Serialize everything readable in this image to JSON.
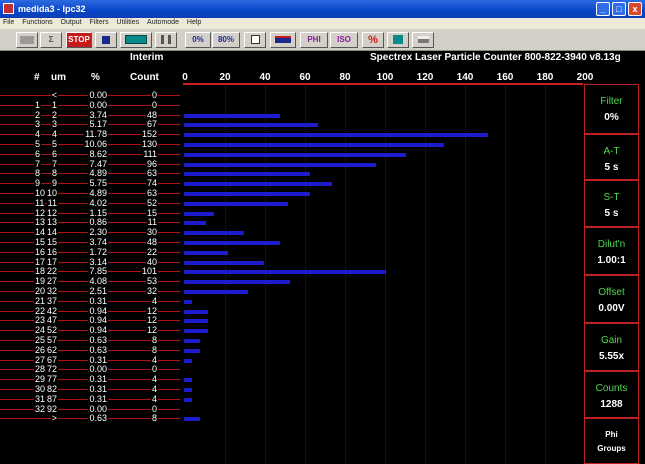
{
  "window": {
    "title": "medida3 - lpc32",
    "min": "_",
    "max": "□",
    "close": "x"
  },
  "menu": [
    "File",
    "Functions",
    "Output",
    "Filters",
    "Utilities",
    "Automode",
    "Help"
  ],
  "toolbar": {
    "sigma": "Σ",
    "stop": "STOP",
    "percent_label": "0%",
    "percent80_label": "80%",
    "phi": "PHI",
    "iso": "ISO",
    "pct_sym": "%"
  },
  "header": {
    "hash": "#",
    "um": "um",
    "pct": "%",
    "interim": "Interim",
    "count": "Count",
    "banner": "Spectrex  Laser Particle Counter 800-822-3940 v8.13g"
  },
  "scale": [
    "0",
    "20",
    "40",
    "60",
    "80",
    "100",
    "120",
    "140",
    "160",
    "180",
    "200"
  ],
  "rows": [
    {
      "n": "",
      "um": "<",
      "pct": "0.00",
      "count": 0
    },
    {
      "n": "1",
      "um": "1",
      "pct": "0.00",
      "count": 0
    },
    {
      "n": "2",
      "um": "2",
      "pct": "3.74",
      "count": 48
    },
    {
      "n": "3",
      "um": "3",
      "pct": "5.17",
      "count": 67
    },
    {
      "n": "4",
      "um": "4",
      "pct": "11.78",
      "count": 152
    },
    {
      "n": "5",
      "um": "5",
      "pct": "10.06",
      "count": 130
    },
    {
      "n": "6",
      "um": "6",
      "pct": "8.62",
      "count": 111
    },
    {
      "n": "7",
      "um": "7",
      "pct": "7.47",
      "count": 96
    },
    {
      "n": "8",
      "um": "8",
      "pct": "4.89",
      "count": 63
    },
    {
      "n": "9",
      "um": "9",
      "pct": "5.75",
      "count": 74
    },
    {
      "n": "10",
      "um": "10",
      "pct": "4.89",
      "count": 63
    },
    {
      "n": "11",
      "um": "11",
      "pct": "4.02",
      "count": 52
    },
    {
      "n": "12",
      "um": "12",
      "pct": "1.15",
      "count": 15
    },
    {
      "n": "13",
      "um": "13",
      "pct": "0.86",
      "count": 11
    },
    {
      "n": "14",
      "um": "14",
      "pct": "2.30",
      "count": 30
    },
    {
      "n": "15",
      "um": "15",
      "pct": "3.74",
      "count": 48
    },
    {
      "n": "16",
      "um": "16",
      "pct": "1.72",
      "count": 22
    },
    {
      "n": "17",
      "um": "17",
      "pct": "3.14",
      "count": 40
    },
    {
      "n": "18",
      "um": "22",
      "pct": "7.85",
      "count": 101
    },
    {
      "n": "19",
      "um": "27",
      "pct": "4.08",
      "count": 53
    },
    {
      "n": "20",
      "um": "32",
      "pct": "2.51",
      "count": 32
    },
    {
      "n": "21",
      "um": "37",
      "pct": "0.31",
      "count": 4
    },
    {
      "n": "22",
      "um": "42",
      "pct": "0.94",
      "count": 12
    },
    {
      "n": "23",
      "um": "47",
      "pct": "0.94",
      "count": 12
    },
    {
      "n": "24",
      "um": "52",
      "pct": "0.94",
      "count": 12
    },
    {
      "n": "25",
      "um": "57",
      "pct": "0.63",
      "count": 8
    },
    {
      "n": "26",
      "um": "62",
      "pct": "0.63",
      "count": 8
    },
    {
      "n": "27",
      "um": "67",
      "pct": "0.31",
      "count": 4
    },
    {
      "n": "28",
      "um": "72",
      "pct": "0.00",
      "count": 0
    },
    {
      "n": "29",
      "um": "77",
      "pct": "0.31",
      "count": 4
    },
    {
      "n": "30",
      "um": "82",
      "pct": "0.31",
      "count": 4
    },
    {
      "n": "31",
      "um": "87",
      "pct": "0.31",
      "count": 4
    },
    {
      "n": "32",
      "um": "92",
      "pct": "0.00",
      "count": 0
    },
    {
      "n": "",
      "um": ">",
      "pct": "0.63",
      "count": 8
    }
  ],
  "panel": {
    "filter": {
      "label": "Filter",
      "value": "0%"
    },
    "at": {
      "label": "A-T",
      "value": "5 s"
    },
    "st": {
      "label": "S-T",
      "value": "5 s"
    },
    "dilut": {
      "label": "Dilut'n",
      "value": "1.00:1"
    },
    "offset": {
      "label": "Offset",
      "value": "0.00V"
    },
    "gain": {
      "label": "Gain",
      "value": "5.55x"
    },
    "counts": {
      "label": "Counts",
      "value": "1288"
    },
    "phi": {
      "label": "Phi",
      "value": "Groups"
    }
  },
  "colors": {
    "bar": "#1c1ccc",
    "line": "#b01010",
    "panel_label": "#4fd84f"
  },
  "chart_data": {
    "type": "bar",
    "orientation": "horizontal",
    "xlim": [
      0,
      200
    ],
    "categories": [
      "<",
      "1",
      "2",
      "3",
      "4",
      "5",
      "6",
      "7",
      "8",
      "9",
      "10",
      "11",
      "12",
      "13",
      "14",
      "15",
      "16",
      "17",
      "22",
      "27",
      "32",
      "37",
      "42",
      "47",
      "52",
      "57",
      "62",
      "67",
      "72",
      "77",
      "82",
      "87",
      "92",
      ">"
    ],
    "values": [
      0,
      0,
      48,
      67,
      152,
      130,
      111,
      96,
      63,
      74,
      63,
      52,
      15,
      11,
      30,
      48,
      22,
      40,
      101,
      53,
      32,
      4,
      12,
      12,
      12,
      8,
      8,
      4,
      0,
      4,
      4,
      4,
      0,
      8
    ]
  }
}
